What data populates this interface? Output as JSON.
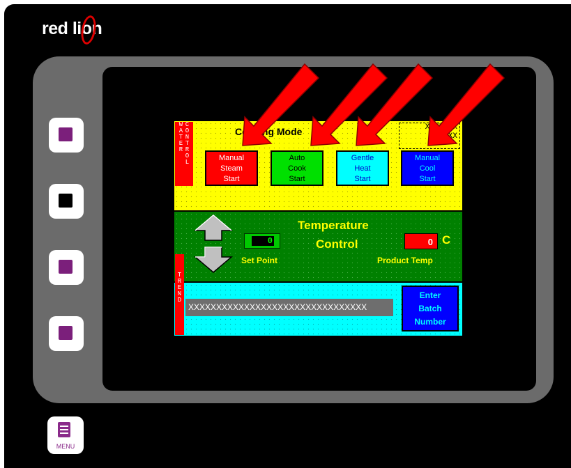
{
  "device": {
    "brand_logo": "red lion",
    "menu_label": "MENU",
    "softkeys": [
      "softkey-1",
      "softkey-2",
      "softkey-3",
      "softkey-4"
    ]
  },
  "hmi": {
    "side_tab_water": {
      "col1": "WATER",
      "col2": "CONTROL"
    },
    "cooking_mode_title": "Cooking Mode",
    "xxx_display": [
      "XXXXXXX",
      "XXXXX"
    ],
    "mode_buttons": [
      {
        "lines": [
          "Manual",
          "Steam",
          "Start"
        ],
        "bg": "#ff0000",
        "fg": "#ffffff"
      },
      {
        "lines": [
          "Auto",
          "Cook",
          "Start"
        ],
        "bg": "#00e000",
        "fg": "#000000"
      },
      {
        "lines": [
          "Gentle",
          "Heat",
          "Start"
        ],
        "bg": "#00ffff",
        "fg": "#0000cc"
      },
      {
        "lines": [
          "Manual",
          "Cool",
          "Start"
        ],
        "bg": "#0000ff",
        "fg": "#00ffff"
      }
    ],
    "temperature_title_1": "Temperature",
    "temperature_title_2": "Control",
    "set_point_value": "0",
    "set_point_label": "Set Point",
    "product_temp_value": "0",
    "product_temp_unit": "C",
    "product_temp_label": "Product Temp",
    "side_tab_trend": "TREND",
    "batch_field_text": "XXXXXXXXXXXXXXXXXXXXXXXXXXXXXXXX",
    "enter_button_lines": [
      "Enter",
      "Batch",
      "Number"
    ]
  },
  "colors": {
    "accent_red": "#ff0000",
    "panel_yellow": "#ffff00",
    "panel_green": "#008000",
    "panel_cyan": "#00ffff"
  }
}
